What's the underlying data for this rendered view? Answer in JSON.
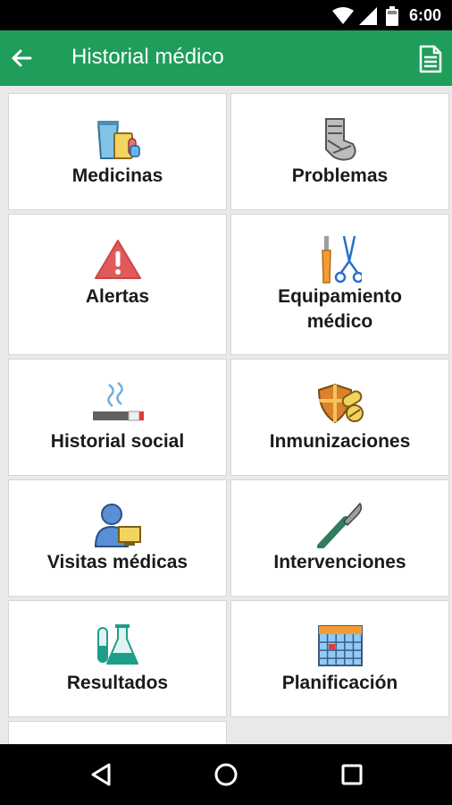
{
  "status_bar": {
    "time": "6:00"
  },
  "app_bar": {
    "title": "Historial médico"
  },
  "tiles": [
    {
      "label": "Medicinas",
      "icon": "medicine-icon"
    },
    {
      "label": "Problemas",
      "icon": "bandage-icon"
    },
    {
      "label": "Alertas",
      "icon": "alert-icon"
    },
    {
      "label": "Equipamiento\nmédico",
      "icon": "medical-tools-icon"
    },
    {
      "label": "Historial social",
      "icon": "cigarette-icon"
    },
    {
      "label": "Inmunizaciones",
      "icon": "shield-pill-icon"
    },
    {
      "label": "Visitas médicas",
      "icon": "doctor-visit-icon"
    },
    {
      "label": "Intervenciones",
      "icon": "scalpel-icon"
    },
    {
      "label": "Resultados",
      "icon": "lab-flask-icon"
    },
    {
      "label": "Planificación",
      "icon": "calendar-icon"
    }
  ],
  "colors": {
    "status_bar": "#000000",
    "app_bar": "#1f9d5b",
    "alert_red": "#e05a5a",
    "icon_teal": "#1f9d8b"
  }
}
